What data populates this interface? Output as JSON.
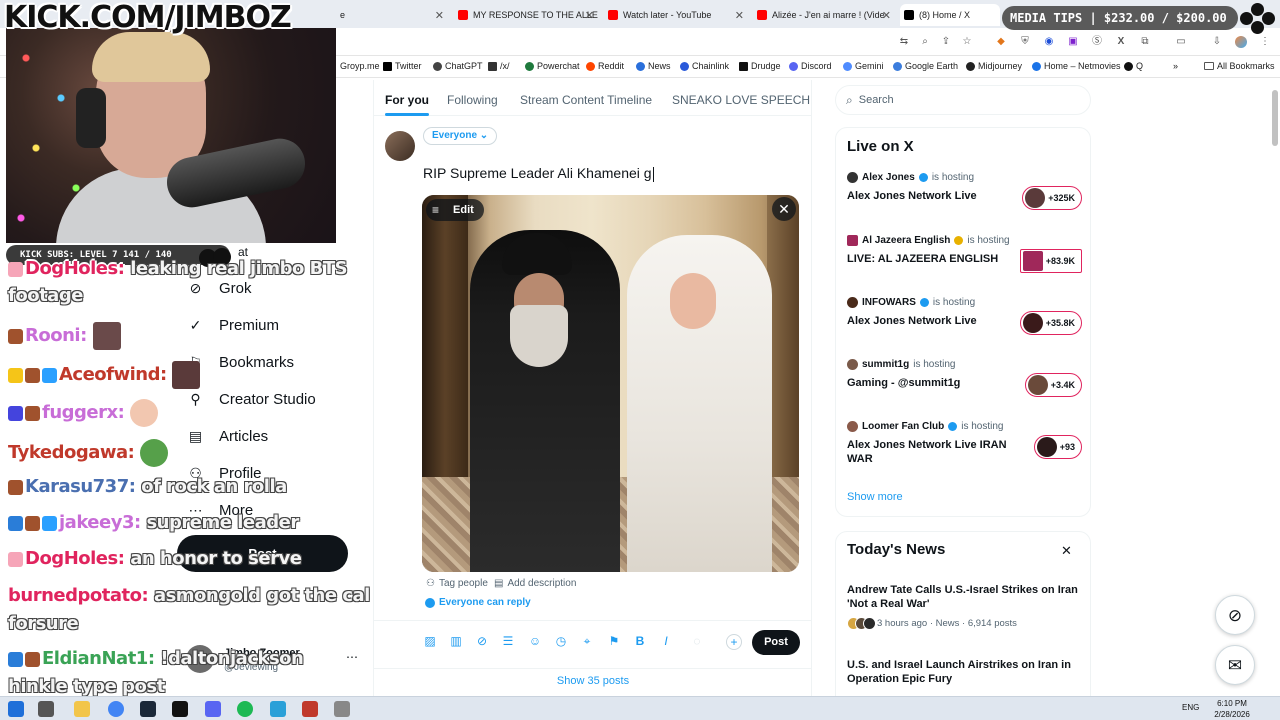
{
  "browser": {
    "tabs": [
      {
        "label": "e",
        "color": "#888888"
      },
      {
        "label": "MY RESPONSE TO THE ALLE",
        "color": "#ff0000"
      },
      {
        "label": "Watch later - YouTube",
        "color": "#ff0000"
      },
      {
        "label": "Alizée - J'en ai marre ! (Vide",
        "color": "#ff0000"
      },
      {
        "label": "(8) Home / X",
        "color": "#000000"
      }
    ],
    "bookmarks": [
      {
        "label": "Groyp.me",
        "color": "#888888"
      },
      {
        "label": "Twitter",
        "color": "#000000"
      },
      {
        "label": "ChatGPT",
        "color": "#444444"
      },
      {
        "label": "/x/",
        "color": "#333333"
      },
      {
        "label": "Powerchat",
        "color": "#1f7a3d"
      },
      {
        "label": "Reddit",
        "color": "#ff4500"
      },
      {
        "label": "News",
        "color": "#2a6fdb"
      },
      {
        "label": "Chainlink",
        "color": "#2a5ada"
      },
      {
        "label": "Drudge",
        "color": "#111111"
      },
      {
        "label": "Discord",
        "color": "#5865f2"
      },
      {
        "label": "Gemini",
        "color": "#4f8cff"
      },
      {
        "label": "Google Earth",
        "color": "#3b7ddd"
      },
      {
        "label": "Midjourney",
        "color": "#222222"
      },
      {
        "label": "Home – Netmovies",
        "color": "#1a73e8"
      },
      {
        "label": "Q",
        "color": "#111111"
      }
    ],
    "all_bookmarks": "All Bookmarks",
    "more_bookmarks": "»"
  },
  "x": {
    "home_tabs": [
      {
        "label": "For you"
      },
      {
        "label": "Following"
      },
      {
        "label": "Stream Content Timeline"
      },
      {
        "label": "SNEAKO LOVE SPEECH"
      }
    ],
    "compose": {
      "audience": "Everyone ⌄",
      "text": "RIP Supreme Leader Ali Khamenei g",
      "edit_label": "Edit",
      "tag_people": "Tag people",
      "add_description": "Add description",
      "reply_setting": "Everyone can reply",
      "post_label": "Post",
      "show_posts": "Show 35 posts"
    },
    "nav": {
      "items": [
        {
          "label": "at",
          "icon": "overflow"
        },
        {
          "label": "Grok",
          "icon": "grok-icon"
        },
        {
          "label": "Premium",
          "icon": "premium-icon"
        },
        {
          "label": "Bookmarks",
          "icon": "bookmark-icon"
        },
        {
          "label": "Creator Studio",
          "icon": "creator-studio-icon"
        },
        {
          "label": "Articles",
          "icon": "articles-icon"
        },
        {
          "label": "Profile",
          "icon": "profile-icon"
        },
        {
          "label": "More",
          "icon": "more-icon"
        }
      ],
      "post_label": "Post",
      "account_name": "Jimbo Zoomer",
      "account_handle": "@Jeviewing"
    },
    "search_placeholder": "Search",
    "live": {
      "title": "Live on X",
      "items": [
        {
          "host": "Alex Jones",
          "verified": "blue",
          "hosting": "is hosting",
          "name": "Alex Jones Network Live",
          "count": "+325K"
        },
        {
          "host": "Al Jazeera English",
          "verified": "gold",
          "hosting": "is hosting",
          "name": "LIVE: AL JAZEERA ENGLISH",
          "count": "+83.9K"
        },
        {
          "host": "INFOWARS",
          "verified": "blue",
          "hosting": "is hosting",
          "name": "Alex Jones Network Live",
          "count": "+35.8K"
        },
        {
          "host": "summit1g",
          "verified": "none",
          "hosting": "is hosting",
          "name": "Gaming - @summit1g",
          "count": "+3.4K"
        },
        {
          "host": "Loomer Fan Club",
          "verified": "blue",
          "hosting": "is hosting",
          "name": "Alex Jones Network Live IRAN WAR",
          "count": "+93"
        }
      ],
      "show_more": "Show more"
    },
    "news": {
      "title": "Today's News",
      "items": [
        {
          "headline": "Andrew Tate Calls U.S.-Israel Strikes on Iran 'Not a Real War'",
          "meta": "3 hours ago · News · 6,914 posts"
        },
        {
          "headline": "U.S. and Israel Launch Airstrikes on Iran in Operation Epic Fury",
          "meta": ""
        }
      ]
    }
  },
  "overlay": {
    "kick_url": "KICK.COM/JIMBOZ",
    "subs": "KICK SUBS: LEVEL 7 141 / 140",
    "media_tips": "MEDIA TIPS | $232.00 / $200.00",
    "chat": [
      {
        "user": "DogHoles:",
        "msg": "leaking real jimbo BTS",
        "color": "#e0245e"
      },
      {
        "user": "",
        "msg": "footage",
        "color": "#e0245e"
      },
      {
        "user": "Rooni:",
        "msg": "",
        "color": "#c86dd7"
      },
      {
        "user": "Aceofwind:",
        "msg": "",
        "color": "#c0392b"
      },
      {
        "user": "fuggerx:",
        "msg": "",
        "color": "#c86dd7"
      },
      {
        "user": "Tykedogawa:",
        "msg": "",
        "color": "#c0392b"
      },
      {
        "user": "Karasu737:",
        "msg": "of rock an rolla",
        "color": "#4a6fb0"
      },
      {
        "user": "jakeey3:",
        "msg": "supreme leader",
        "color": "#c86dd7"
      },
      {
        "user": "DogHoles:",
        "msg": "an honor to serve",
        "color": "#e0245e"
      },
      {
        "user": "burnedpotato:",
        "msg": "asmongold got the cal",
        "color": "#e0245e"
      },
      {
        "user": "",
        "msg": "forsure",
        "color": "#e0245e"
      },
      {
        "user": "EldianNat1:",
        "msg": "!daltonjackson",
        "color": "#3aa356"
      },
      {
        "user": "",
        "msg": "hinkle type post",
        "color": "#3aa356"
      }
    ]
  },
  "taskbar": {
    "lang": "ENG",
    "time": "6:10 PM",
    "date": "2/28/2026"
  }
}
